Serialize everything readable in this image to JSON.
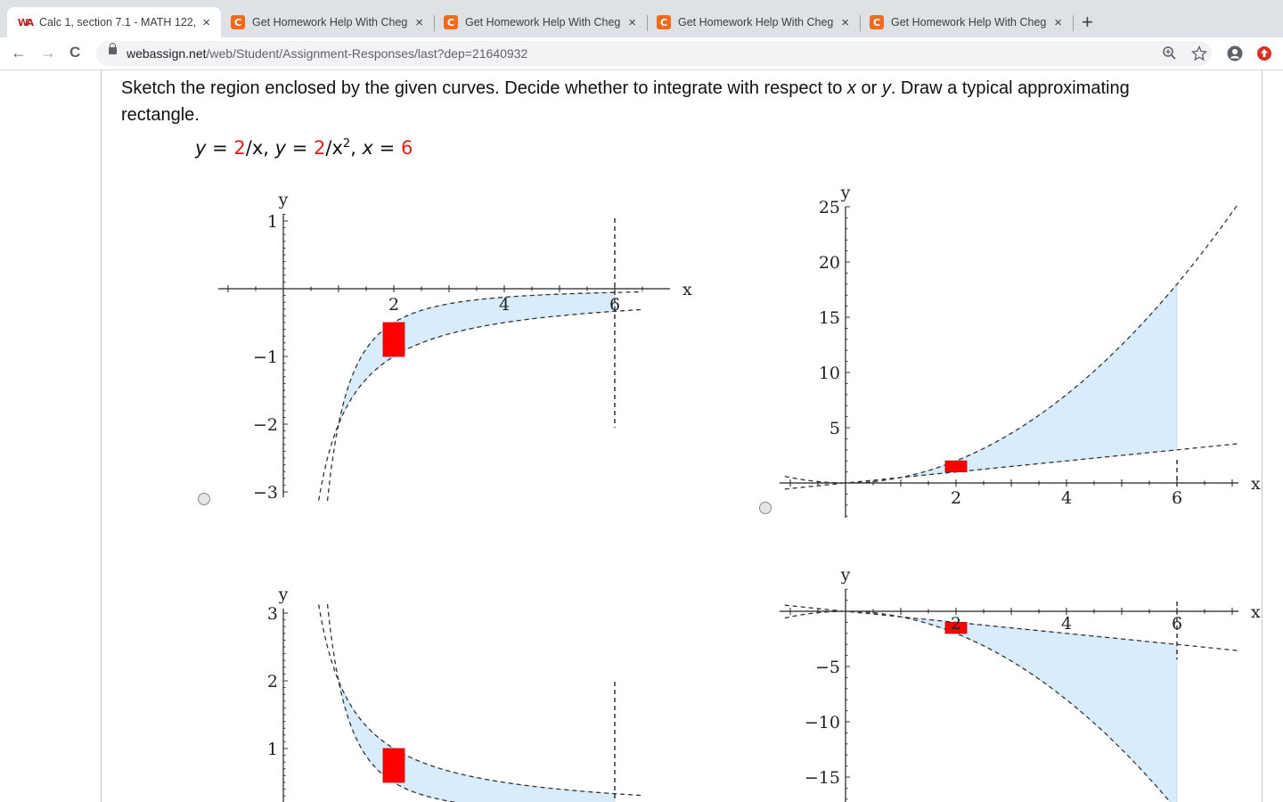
{
  "browser": {
    "tabs": [
      {
        "title": "Calc 1, section 7.1 - MATH 122,",
        "favicon": "webassign-icon",
        "active": true
      },
      {
        "title": "Get Homework Help With Cheg",
        "favicon": "chegg-icon",
        "active": false
      },
      {
        "title": "Get Homework Help With Cheg",
        "favicon": "chegg-icon",
        "active": false
      },
      {
        "title": "Get Homework Help With Cheg",
        "favicon": "chegg-icon",
        "active": false
      },
      {
        "title": "Get Homework Help With Cheg",
        "favicon": "chegg-icon",
        "active": false
      }
    ],
    "close_glyph": "×",
    "new_tab_glyph": "+",
    "url_host": "webassign.net",
    "url_path": "/web/Student/Assignment-Responses/last?dep=21640932",
    "back_glyph": "←",
    "forward_glyph": "→",
    "reload_glyph": "C"
  },
  "question": {
    "prompt_part1": "Sketch the region enclosed by the given curves. Decide whether to integrate with respect to ",
    "var_x": "x",
    "prompt_or": " or ",
    "var_y": "y",
    "prompt_part2": ". Draw a typical approximating rectangle.",
    "equation": {
      "y1_lhs": "y",
      "eq": " = ",
      "y1_num": "2",
      "y1_den": "/x,  ",
      "y2_lhs": "y",
      "y2_num": "2",
      "y2_den": "/x",
      "y2_exp": "2",
      "sep": ",  ",
      "x_lhs": "x",
      "x_val": "6"
    }
  },
  "colors": {
    "accent_red": "#e0201b",
    "region_fill": "#d8ecfb",
    "rect_fill": "#ff0000"
  },
  "answer_options": [
    {
      "id": "A",
      "chart_data": {
        "type": "area",
        "xlabel": "x",
        "ylabel": "y",
        "xlim": [
          -1.2,
          7.3
        ],
        "ylim": [
          -3.0,
          1.0
        ],
        "xticks": [
          2,
          4,
          6
        ],
        "yticks": [
          1,
          -1,
          -2,
          -3
        ],
        "series": [
          {
            "formula": "-2/x^2",
            "style": "dashed"
          },
          {
            "formula": "-2/x",
            "style": "dashed"
          },
          {
            "formula": "x = 6",
            "style": "dashed vertical"
          }
        ],
        "shaded_region": {
          "x_from": 1,
          "x_to": 6
        },
        "rectangle": {
          "x": 2,
          "y_top": -0.5,
          "y_bottom": -1.0
        }
      }
    },
    {
      "id": "B",
      "chart_data": {
        "type": "area",
        "xlabel": "x",
        "ylabel": "y",
        "xlim": [
          -1.2,
          7.3
        ],
        "ylim": [
          -0.5,
          25
        ],
        "xticks": [
          2,
          4,
          6
        ],
        "yticks": [
          5,
          10,
          15,
          20,
          25
        ],
        "series": [
          {
            "formula": "x^2/2",
            "style": "dashed"
          },
          {
            "formula": "x/2",
            "style": "dashed"
          },
          {
            "formula": "x = 6",
            "style": "dashed vertical"
          }
        ],
        "shaded_region": {
          "x_from": 1,
          "x_to": 6
        },
        "rectangle": {
          "x": 2,
          "y_top": 2,
          "y_bottom": 1
        }
      }
    },
    {
      "id": "C",
      "chart_data": {
        "type": "area",
        "xlabel": "x",
        "ylabel": "y",
        "xlim": [
          -1.2,
          7.3
        ],
        "ylim": [
          0,
          3.0
        ],
        "xticks": [
          2,
          4,
          6
        ],
        "yticks": [
          1,
          2,
          3
        ],
        "series": [
          {
            "formula": "2/x",
            "style": "dashed"
          },
          {
            "formula": "2/x^2",
            "style": "dashed"
          },
          {
            "formula": "x = 6",
            "style": "dashed vertical"
          }
        ],
        "shaded_region": {
          "x_from": 1,
          "x_to": 6
        },
        "rectangle": {
          "x": 2,
          "y_top": 1.0,
          "y_bottom": 0.5
        }
      }
    },
    {
      "id": "D",
      "chart_data": {
        "type": "area",
        "xlabel": "x",
        "ylabel": "y",
        "xlim": [
          -1.2,
          7.3
        ],
        "ylim": [
          -18,
          0.5
        ],
        "xticks": [
          2,
          4,
          6
        ],
        "yticks": [
          -5,
          -10,
          -15
        ],
        "series": [
          {
            "formula": "-x/2",
            "style": "dashed"
          },
          {
            "formula": "-x^2/2",
            "style": "dashed"
          },
          {
            "formula": "x = 6",
            "style": "dashed vertical"
          }
        ],
        "shaded_region": {
          "x_from": 1,
          "x_to": 6
        },
        "rectangle": {
          "x": 2,
          "y_top": -1,
          "y_bottom": -2
        }
      }
    }
  ]
}
